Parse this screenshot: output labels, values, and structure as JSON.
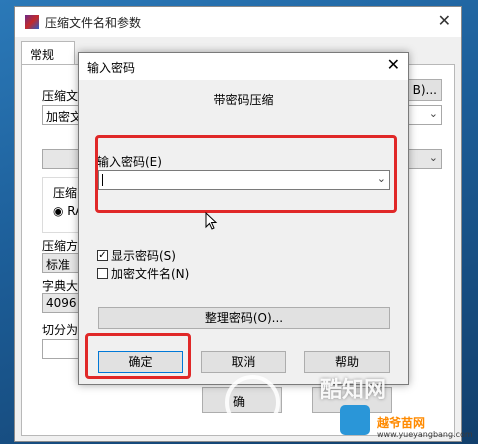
{
  "back_window": {
    "title": "压缩文件名和参数",
    "tab_general": "常规",
    "archive_label": "压缩文",
    "archive_value": "加密文",
    "browse_label": "B)...",
    "format_label": "压缩",
    "format_option": "RA",
    "method_label": "压缩方",
    "method_value": "标准",
    "dict_label": "字典大",
    "dict_value": "4096",
    "split_label": "切分为",
    "ok_button": "确",
    "close_symbol": "✕"
  },
  "dialog": {
    "title": "输入密码",
    "close_symbol": "✕",
    "heading": "带密码压缩",
    "password_label": "输入密码(E)",
    "password_value": "",
    "show_password_label": "显示密码(S)",
    "show_password_checked": true,
    "encrypt_names_label": "加密文件名(N)",
    "encrypt_names_checked": false,
    "organize_button": "整理密码(O)...",
    "ok_button": "确定",
    "cancel_button": "取消",
    "help_button": "帮助"
  },
  "watermark": {
    "brand": "酷知网",
    "site_name": "越爷苗网",
    "site_url": "www.yueyangbang.com"
  },
  "colors": {
    "highlight": "#e02828",
    "default_button_border": "#0078d7"
  }
}
